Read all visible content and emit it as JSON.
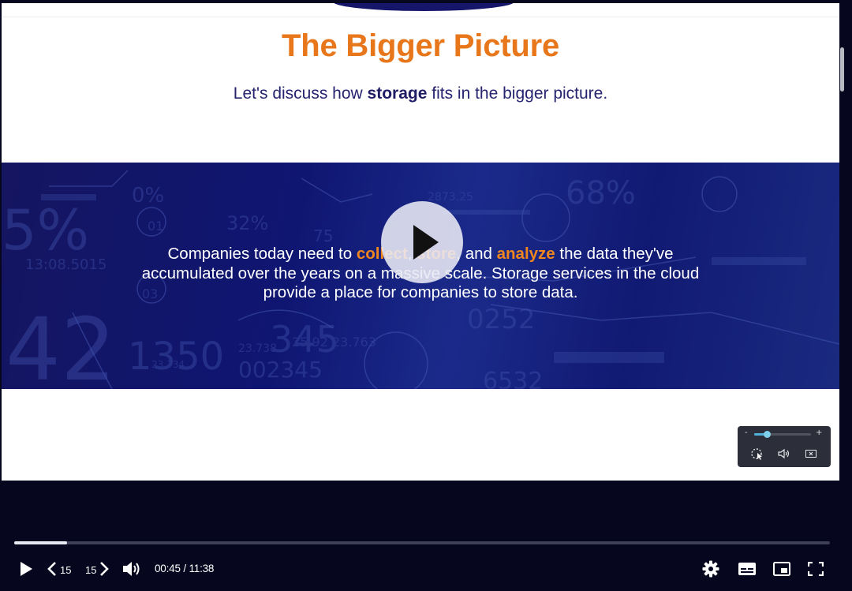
{
  "slide": {
    "title": "The Bigger Picture",
    "subtitle_pre": "Let's discuss how ",
    "subtitle_bold": "storage",
    "subtitle_post": " fits in the bigger picture.",
    "banner": {
      "t1": "Companies today need to ",
      "collect": "collect",
      "t2": ", ",
      "store": "store",
      "t3": ", and ",
      "analyze": "analyze",
      "t4": " the data they've accumulated over the years on a massive scale. Storage services in the cloud provide a place for companies to store data."
    }
  },
  "mini_player": {
    "minus": "-",
    "plus": "+",
    "volume_fraction": 0.22
  },
  "player": {
    "skip_back_label": "15",
    "skip_forward_label": "15",
    "current_time": "00:45",
    "separator": " / ",
    "duration": "11:38",
    "progress_fraction": 0.065
  },
  "colors": {
    "accent_orange": "#e8771c",
    "navy": "#26246e",
    "player_bg": "#06061f"
  }
}
